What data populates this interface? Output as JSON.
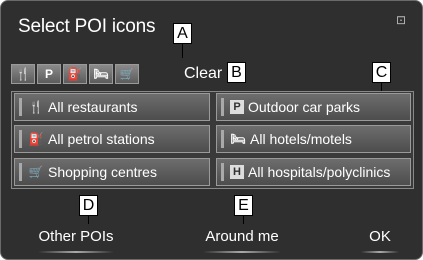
{
  "title": "Select POI icons",
  "selected_icons": [
    {
      "name": "restaurant-icon",
      "glyph": "🍴"
    },
    {
      "name": "parking-icon",
      "glyph": "P"
    },
    {
      "name": "petrol-icon",
      "glyph": "⛽"
    },
    {
      "name": "hotel-icon",
      "glyph": "🛏"
    },
    {
      "name": "shopping-icon",
      "glyph": "🛒"
    }
  ],
  "clear_label": "Clear",
  "categories": [
    {
      "label": "All restaurants",
      "icon": "restaurant-icon",
      "glyph": "🍴"
    },
    {
      "label": "Outdoor car parks",
      "icon": "parking-icon",
      "glyph": "P"
    },
    {
      "label": "All petrol stations",
      "icon": "petrol-icon",
      "glyph": "⛽"
    },
    {
      "label": "All hotels/motels",
      "icon": "hotel-icon",
      "glyph": "🛏"
    },
    {
      "label": "Shopping centres",
      "icon": "shopping-icon",
      "glyph": "🛒"
    },
    {
      "label": "All hospitals/polyclinics",
      "icon": "hospital-icon",
      "glyph": "H"
    }
  ],
  "bottom_buttons": {
    "other": "Other POIs",
    "around": "Around me",
    "ok": "OK"
  },
  "callouts": {
    "a": "A",
    "b": "B",
    "c": "C",
    "d": "D",
    "e": "E"
  }
}
